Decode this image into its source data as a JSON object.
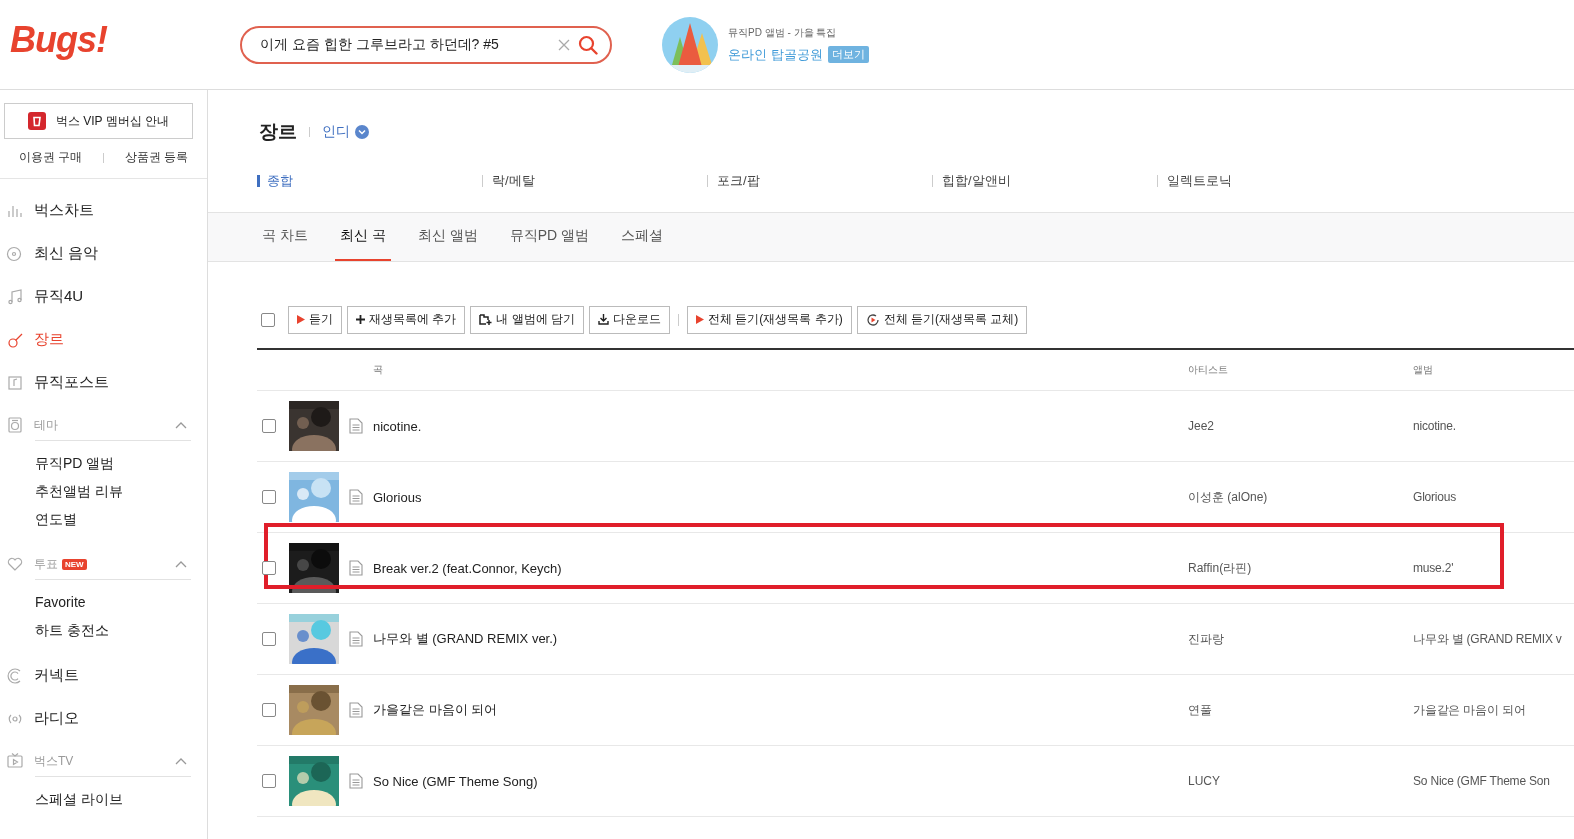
{
  "header": {
    "logo": "Bugs!",
    "search": {
      "value": "이게 요즘 힙한 그루브라고 하던데? #5"
    },
    "promo": {
      "subtitle": "뮤직PD 앨범 - 가을 특집",
      "title": "온라인 탑골공원",
      "badge": "더보기"
    }
  },
  "sidebar": {
    "vip_button": "벅스 VIP 멤버십 안내",
    "links": [
      "이용권 구매",
      "상품권 등록"
    ],
    "nav": [
      {
        "kind": "link",
        "label": "벅스차트",
        "selected": false
      },
      {
        "kind": "link",
        "label": "최신 음악",
        "selected": false
      },
      {
        "kind": "link",
        "label": "뮤직4U",
        "selected": false
      },
      {
        "kind": "link",
        "label": "장르",
        "selected": true
      },
      {
        "kind": "link",
        "label": "뮤직포스트",
        "selected": false
      },
      {
        "kind": "section",
        "label": "테마",
        "expanded": true,
        "children": [
          "뮤직PD 앨범",
          "추천앨범 리뷰",
          "연도별"
        ]
      },
      {
        "kind": "section",
        "label": "투표",
        "badge": "NEW",
        "expanded": true,
        "children": [
          "Favorite",
          "하트 충전소"
        ]
      },
      {
        "kind": "link",
        "label": "커넥트",
        "selected": false
      },
      {
        "kind": "link",
        "label": "라디오",
        "selected": false
      },
      {
        "kind": "section",
        "label": "벅스TV",
        "expanded": true,
        "children": [
          "스페셜 라이브"
        ]
      }
    ]
  },
  "genre": {
    "title": "장르",
    "filter": "인디",
    "subgenres": [
      {
        "label": "종합",
        "selected": true
      },
      {
        "label": "락/메탈",
        "selected": false
      },
      {
        "label": "포크/팝",
        "selected": false
      },
      {
        "label": "힙합/알앤비",
        "selected": false
      },
      {
        "label": "일렉트로닉",
        "selected": false
      }
    ]
  },
  "tabs": [
    {
      "label": "곡 차트",
      "selected": false
    },
    {
      "label": "최신 곡",
      "selected": true
    },
    {
      "label": "최신 앨범",
      "selected": false
    },
    {
      "label": "뮤직PD 앨범",
      "selected": false
    },
    {
      "label": "스페셜",
      "selected": false
    }
  ],
  "toolbar": {
    "select_all": {
      "checked": false
    },
    "buttons": [
      {
        "kind": "play",
        "label": "듣기",
        "separator_before": false
      },
      {
        "kind": "plus",
        "label": "재생목록에 추가",
        "separator_before": false
      },
      {
        "kind": "album",
        "label": "내 앨범에 담기",
        "separator_before": false
      },
      {
        "kind": "download",
        "label": "다운로드",
        "separator_before": false
      },
      {
        "kind": "play",
        "label": "전체 듣기(재생목록 추가)",
        "separator_before": true
      },
      {
        "kind": "replace",
        "label": "전체 듣기(재생목록 교체)",
        "separator_before": false
      }
    ]
  },
  "table": {
    "columns": [
      "곡",
      "아티스트",
      "앨범"
    ],
    "rows": [
      {
        "title": "nicotine.",
        "artist": "Jee2",
        "album": "nicotine.",
        "checked": false,
        "highlighted": false
      },
      {
        "title": "Glorious",
        "artist": "이성훈 (alOne)",
        "album": "Glorious",
        "checked": false,
        "highlighted": false
      },
      {
        "title": "Break ver.2 (feat.Connor, Keych)",
        "artist": "Raffin(라핀)",
        "album": "muse.2'",
        "checked": false,
        "highlighted": true
      },
      {
        "title": "나무와 별 (GRAND REMIX ver.)",
        "artist": "진파랑",
        "album": "나무와 별 (GRAND REMIX v",
        "checked": false,
        "highlighted": false
      },
      {
        "title": "가을같은 마음이 되어",
        "artist": "연풀",
        "album": "가을같은 마음이 되어",
        "checked": false,
        "highlighted": false
      },
      {
        "title": "So Nice (GMF Theme Song)",
        "artist": "LUCY",
        "album": "So Nice (GMF Theme Son",
        "checked": false,
        "highlighted": false
      }
    ]
  }
}
